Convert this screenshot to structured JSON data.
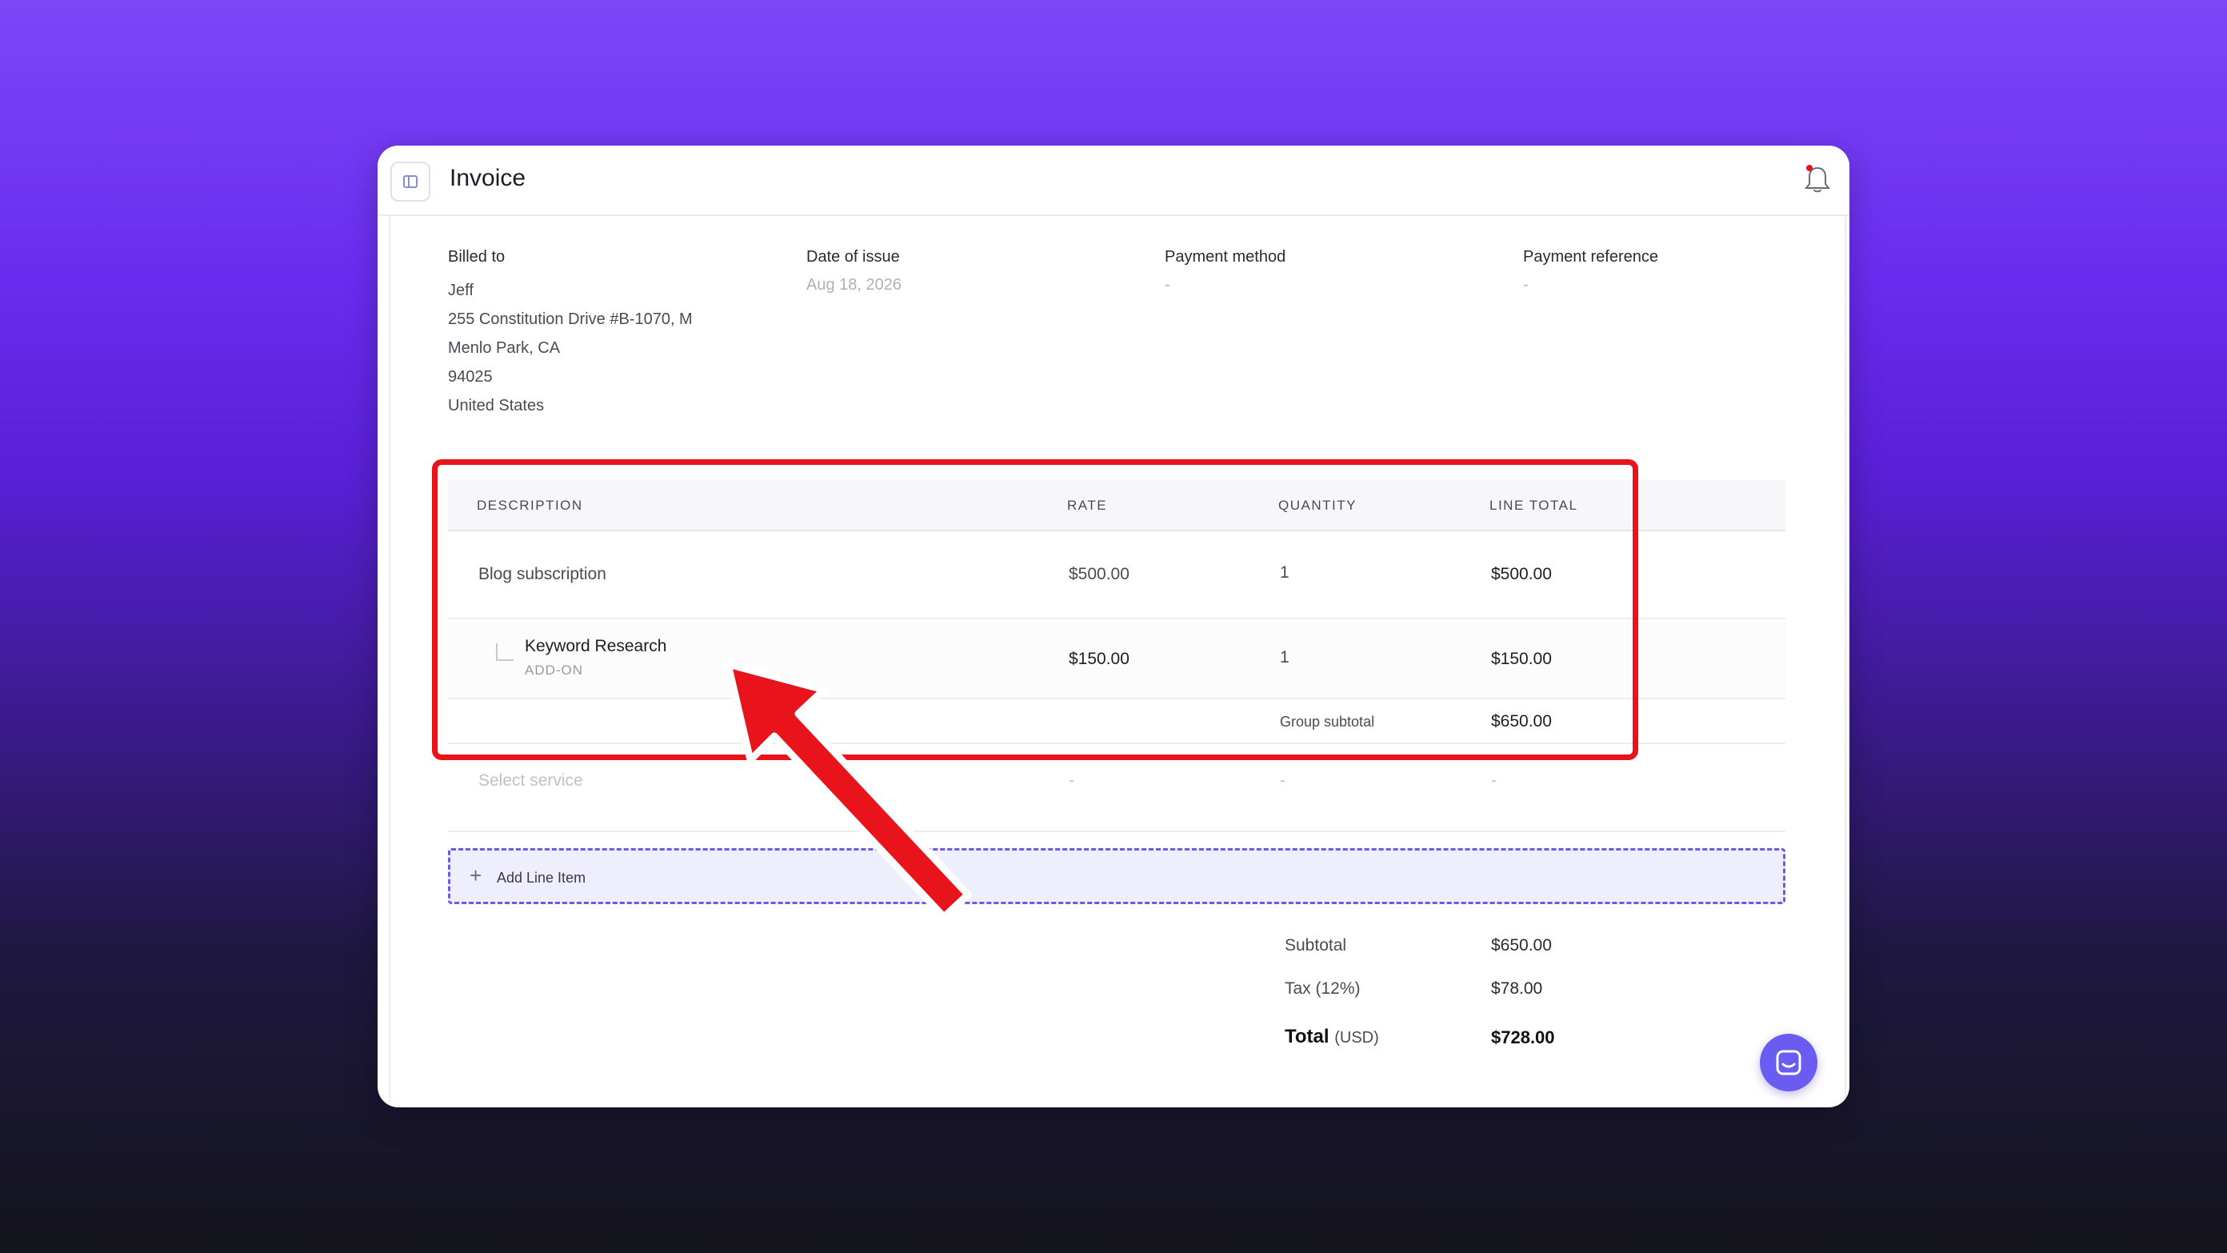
{
  "header": {
    "title": "Invoice"
  },
  "meta": {
    "billed_to": {
      "label": "Billed to",
      "name": "Jeff",
      "address": [
        "255 Constitution Drive #B-1070, M",
        "Menlo Park, CA",
        "94025",
        "United States"
      ]
    },
    "date_of_issue": {
      "label": "Date of issue",
      "value": "Aug 18, 2026"
    },
    "payment_method": {
      "label": "Payment method",
      "value": "-"
    },
    "payment_reference": {
      "label": "Payment reference",
      "value": "-"
    }
  },
  "table": {
    "columns": [
      "DESCRIPTION",
      "RATE",
      "QUANTITY",
      "LINE TOTAL"
    ],
    "rows": [
      {
        "description": "Blog subscription",
        "rate": "$500.00",
        "quantity": "1",
        "line_total": "$500.00"
      },
      {
        "description": "Keyword Research",
        "tag": "ADD-ON",
        "rate": "$150.00",
        "quantity": "1",
        "line_total": "$150.00"
      }
    ],
    "group_subtotal": {
      "label": "Group subtotal",
      "value": "$650.00"
    },
    "empty_row": {
      "placeholder": "Select service",
      "rate": "-",
      "quantity": "-",
      "line_total": "-"
    },
    "add_line_label": "Add Line Item"
  },
  "summary": {
    "subtotal": {
      "label": "Subtotal",
      "value": "$650.00"
    },
    "tax": {
      "label": "Tax (12%)",
      "value": "$78.00"
    },
    "total": {
      "label": "Total",
      "unit": "(USD)",
      "value": "$728.00"
    }
  },
  "icons": {
    "sidebar_toggle": "sidebar-toggle-icon",
    "bell": "bell-icon",
    "chat": "chat-icon",
    "plus": "plus-icon"
  },
  "colors": {
    "accent": "#6a5cf0",
    "highlight": "#e8131b",
    "notification_dot": "#e8131b"
  }
}
